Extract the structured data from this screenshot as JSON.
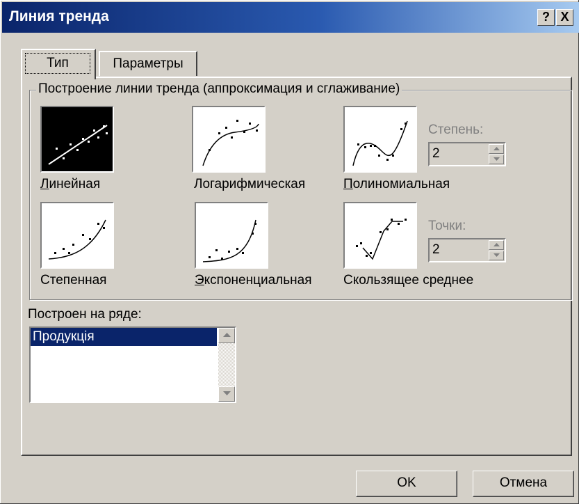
{
  "window": {
    "title": "Линия тренда",
    "help_button": "?",
    "close_button": "X"
  },
  "tabs": [
    {
      "label": "Тип",
      "active": true
    },
    {
      "label": "Параметры",
      "active": false
    }
  ],
  "trend_group": {
    "legend": "Построение линии тренда (аппроксимация и сглаживание)",
    "types": [
      {
        "label": "Линейная",
        "icon": "linear-trend-icon",
        "selected": true
      },
      {
        "label": "Логарифмическая",
        "icon": "logarithmic-trend-icon",
        "selected": false
      },
      {
        "label": "Полиномиальная",
        "icon": "polynomial-trend-icon",
        "selected": false
      },
      {
        "label": "Степенная",
        "icon": "power-trend-icon",
        "selected": false
      },
      {
        "label": "Экспоненциальная",
        "icon": "exponential-trend-icon",
        "selected": false
      },
      {
        "label": "Скользящее среднее",
        "icon": "moving-average-trend-icon",
        "selected": false
      }
    ],
    "degree": {
      "label": "Степень:",
      "value": "2",
      "enabled": false
    },
    "points": {
      "label": "Точки:",
      "value": "2",
      "enabled": false
    }
  },
  "series": {
    "label": "Построен на ряде:",
    "items": [
      "Продукція"
    ],
    "selected": "Продукція"
  },
  "buttons": {
    "ok": "OK",
    "cancel": "Отмена"
  },
  "colors": {
    "titlebar_start": "#0a246a",
    "titlebar_end": "#a6caf0",
    "face": "#d4d0c8",
    "selection": "#0a246a"
  }
}
